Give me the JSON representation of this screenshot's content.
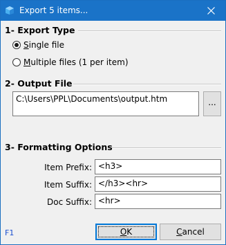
{
  "window": {
    "title": "Export 5 items...",
    "close_label": "×"
  },
  "export_type": {
    "header": "1- Export Type",
    "single": {
      "underline": "S",
      "rest": "ingle file",
      "checked": true
    },
    "multiple": {
      "underline": "M",
      "rest": "ultiple files (1 per item)",
      "checked": false
    }
  },
  "output_file": {
    "header": "2- Output File",
    "path": "C:\\Users\\PPL\\Documents\\output.htm",
    "browse_label": "..."
  },
  "formatting": {
    "header": "3- Formatting Options",
    "item_prefix_label": "Item Prefix:",
    "item_prefix_value": "<h3>",
    "item_suffix_label": "Item Suffix:",
    "item_suffix_value": "</h3><hr>",
    "doc_suffix_label": "Doc Suffix:",
    "doc_suffix_value": "<hr>"
  },
  "footer": {
    "help": "F1",
    "ok_underline": "O",
    "ok_rest": "K",
    "cancel_underline": "C",
    "cancel_rest": "ancel"
  },
  "colors": {
    "titlebar": "#1a73c8",
    "help_link": "#1a4fd0"
  }
}
